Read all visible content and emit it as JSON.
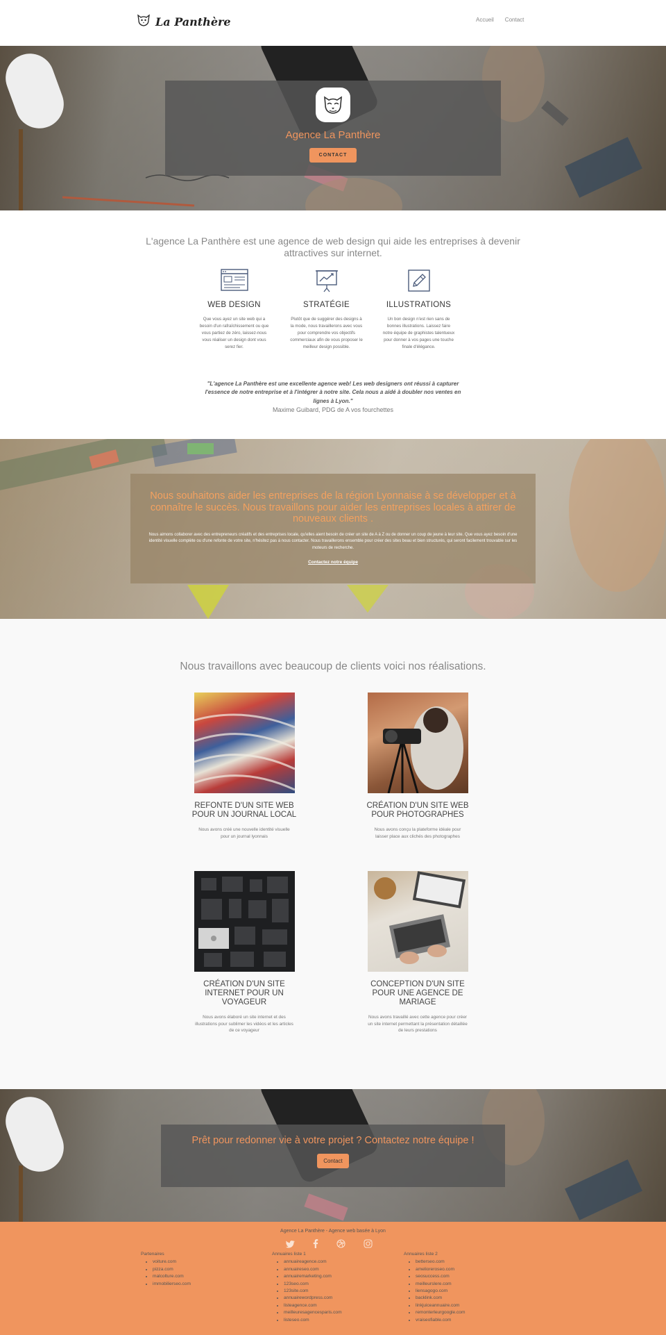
{
  "header": {
    "brand": "La Panthère",
    "nav": [
      "Accueil",
      "Contact"
    ]
  },
  "hero": {
    "title": "Agence La Panthère",
    "button": "CONTACT"
  },
  "intro": {
    "title": "L'agence La Panthère est une agence de web design qui aide les entreprises à devenir attractives sur internet.",
    "services": [
      {
        "icon": "browser-window-icon",
        "title": "WEB DESIGN",
        "desc": "Que vous ayez un site web qui a besoin d'un rafraîchissement ou que vous partiez de zéro, laissez-nous vous réaliser un design dont vous serez fier."
      },
      {
        "icon": "presentation-chart-icon",
        "title": "STRATÉGIE",
        "desc": "Plutôt que de suggérer des designs à la mode, nous travaillerons avec vous pour comprendre vos objectifs commerciaux afin de vous proposer le meilleur design possible."
      },
      {
        "icon": "pencil-icon",
        "title": "ILLUSTRATIONS",
        "desc": "Un bon design n'est rien sans de bonnes illustrations. Laissez faire notre équipe de graphistes talentueux pour donner à vos pages une touche finale d'élégance."
      }
    ],
    "quote": "\"L'agence La Panthère est une excellente agence web! Les web designers ont réussi à capturer l'essence de notre entreprise et à l'intégrer à notre site. Cela nous a aidé à doubler nos ventes en lignes à Lyon.\"",
    "quote_author": "Maxime Guibard, PDG de A vos fourchettes"
  },
  "mission": {
    "title": "Nous souhaitons aider les entreprises de la région Lyonnaise à se développer et à connaître le succès. Nous travaillons pour aider les entreprises locales à attirer de nouveaux clients .",
    "text": "Nous aimons collaborer avec des entrepreneurs créatifs et des entreprises locale, qu'elles aient besoin de créer un site de A à Z ou de donner un coup de jeune à leur site. Que vous ayez besoin d'une identité visuelle complète ou d'une refonte de votre site, n'hésitez pas à nous contacter. Nous travaillerons ensemble pour créer des sites beau et bien structurés, qui seront facilement trouvable sur les moteurs de recherche.",
    "link": "Contactez notre équipe"
  },
  "portfolio": {
    "title": "Nous travaillons avec beaucoup de clients voici nos réalisations.",
    "works": [
      {
        "title": "REFONTE D'UN SITE WEB POUR UN JOURNAL LOCAL",
        "desc": "Nous avons créé une nouvelle identité visuelle pour un journal lyonnais"
      },
      {
        "title": "CRÉATION D'UN SITE WEB POUR PHOTOGRAPHES",
        "desc": "Nous avons conçu la plateforme idéale pour laisser place aux clichés des photographes"
      },
      {
        "title": "CRÉATION D'UN SITE INTERNET POUR UN VOYAGEUR",
        "desc": "Nous avons élaboré un site internet et des illustrations pour sublimer les vidéos et les articles de ce voyageur"
      },
      {
        "title": "CONCEPTION D'UN SITE POUR UNE AGENCE DE MARIAGE",
        "desc": "Nous avons travaillé avec cette agence pour créer un site internet permettant la présentation détaillée de leurs prestations"
      }
    ]
  },
  "cta": {
    "title": "Prêt pour redonner vie à votre projet ? Contactez notre équipe !",
    "button": "Contact"
  },
  "footer": {
    "title": "Agence La Panthère - Agence web basée à Lyon",
    "social_icons": [
      "twitter-icon",
      "facebook-icon",
      "dribbble-icon",
      "instagram-icon"
    ],
    "columns": [
      {
        "heading": "Partenaires",
        "links": [
          "voiture.com",
          "pizza.com",
          "malcolture.com",
          "immobilierseo.com"
        ]
      },
      {
        "heading": "Annuaires liste 1",
        "links": [
          "annuaireagence.com",
          "annuaireseo.com",
          "annuairemarketing.com",
          "123seo.com",
          "123site.com",
          "annuairewordpress.com",
          "listeagence.com",
          "meilleuresagencesparis.com",
          "listeseo.com"
        ]
      },
      {
        "heading": "Annuaires liste 2",
        "links": [
          "betterseo.com",
          "amelioreroseo.com",
          "seosuccess.com",
          "meilleurslere.com",
          "liensagogo.com",
          "backlink.com",
          "linkjuiceannuaire.com",
          "remonterleurgoogle.com",
          "vraiseofiable.com"
        ]
      }
    ]
  },
  "colors": {
    "accent": "#f0955e",
    "card_overlay": "#555555"
  }
}
